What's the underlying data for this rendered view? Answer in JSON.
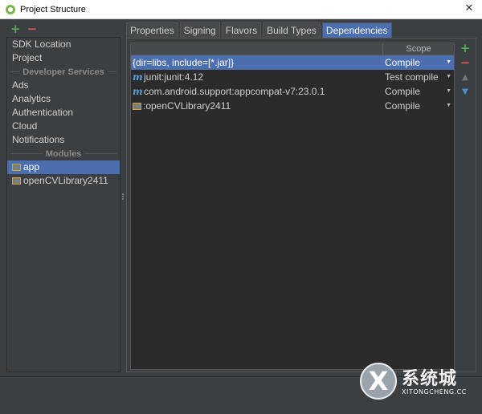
{
  "window": {
    "title": "Project Structure",
    "close_glyph": "✕"
  },
  "left": {
    "toolbar": {
      "add": "+",
      "remove": "−"
    },
    "items_top": [
      "SDK Location",
      "Project"
    ],
    "section_developer": "Developer Services",
    "developer_items": [
      "Ads",
      "Analytics",
      "Authentication",
      "Cloud",
      "Notifications"
    ],
    "section_modules": "Modules",
    "modules": [
      {
        "label": "app",
        "selected": true
      },
      {
        "label": "openCVLibrary2411",
        "selected": false
      }
    ]
  },
  "tabs": [
    {
      "label": "Properties",
      "active": false
    },
    {
      "label": "Signing",
      "active": false
    },
    {
      "label": "Flavors",
      "active": false
    },
    {
      "label": "Build Types",
      "active": false
    },
    {
      "label": "Dependencies",
      "active": true
    }
  ],
  "dependencies": {
    "scope_header": "Scope",
    "rows": [
      {
        "icon": "none",
        "name": "{dir=libs, include=[*.jar]}",
        "scope": "Compile",
        "selected": true
      },
      {
        "icon": "maven-icon",
        "icon_glyph": "m",
        "name": "junit:junit:4.12",
        "scope": "Test compile",
        "selected": false
      },
      {
        "icon": "maven-icon",
        "icon_glyph": "m",
        "name": "com.android.support:appcompat-v7:23.0.1",
        "scope": "Compile",
        "selected": false
      },
      {
        "icon": "module-icon",
        "name": ":openCVLibrary2411",
        "scope": "Compile",
        "selected": false
      }
    ],
    "caret_glyph": "▼",
    "tools": {
      "add": "+",
      "remove": "−",
      "up": "▲",
      "down": "▼"
    }
  },
  "watermark": {
    "glyph": "X",
    "text": "系统城",
    "sub": "XITONGCHENG.CC"
  },
  "colors": {
    "background": "#3c3f41",
    "selection": "#4b6eaf",
    "add": "#4caf50",
    "remove": "#e05555"
  }
}
